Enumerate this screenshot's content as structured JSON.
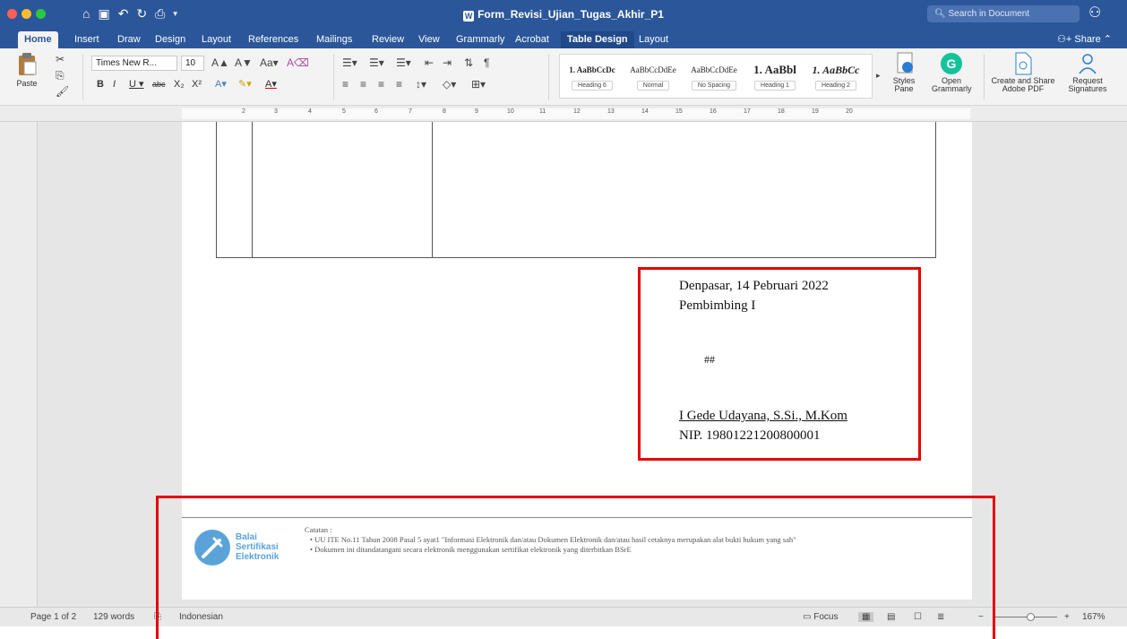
{
  "window": {
    "title": "Form_Revisi_Ujian_Tugas_Akhir_P1",
    "search_placeholder": "Search in Document",
    "traffic_colors": [
      "#fd5f57",
      "#febc2e",
      "#28c840"
    ]
  },
  "tabs": [
    {
      "label": "Home",
      "active": true
    },
    {
      "label": "Insert"
    },
    {
      "label": "Draw"
    },
    {
      "label": "Design"
    },
    {
      "label": "Layout"
    },
    {
      "label": "References"
    },
    {
      "label": "Mailings"
    },
    {
      "label": "Review"
    },
    {
      "label": "View"
    },
    {
      "label": "Grammarly"
    },
    {
      "label": "Acrobat"
    },
    {
      "label": "Table Design",
      "contextual": true
    },
    {
      "label": "Layout"
    }
  ],
  "share_label": "Share",
  "ribbon": {
    "paste_label": "Paste",
    "font_name": "Times New R...",
    "font_size": "10",
    "styles": [
      {
        "sample": "1. AaBbCcDc",
        "name": "Heading 6"
      },
      {
        "sample": "AaBbCcDdEe",
        "name": "Normal"
      },
      {
        "sample": "AaBbCcDdEe",
        "name": "No Spacing"
      },
      {
        "sample": "1. AaBbl",
        "name": "Heading 1"
      },
      {
        "sample": "1. AaBbCc",
        "name": "Heading 2"
      }
    ],
    "styles_pane_label": "Styles Pane",
    "open_grammarly_label": "Open Grammarly",
    "create_share_pdf_label": "Create and Share Adobe PDF",
    "request_signatures_label": "Request Signatures"
  },
  "ruler_numbers": [
    "2",
    "3",
    "4",
    "5",
    "6",
    "7",
    "8",
    "9",
    "10",
    "11",
    "12",
    "13",
    "14",
    "15",
    "16",
    "17",
    "18",
    "19",
    "20"
  ],
  "document": {
    "place_date": "Denpasar, 14 Pebruari 2022",
    "role": "Pembimbing I",
    "signature_placeholder": "##",
    "signer_name": "I Gede Udayana, S.Si., M.Kom",
    "signer_nip": "NIP. 19801221200800001"
  },
  "footer": {
    "logo_lines": [
      "Balai",
      "Sertifikasi",
      "Elektronik"
    ],
    "notes_title": "Catatan :",
    "notes": [
      "UU ITE No.11 Tahun 2008 Pasal 5 ayat1 \"Informasi Elektronik dan/atau Dokumen Elektronik dan/atau hasil cetaknya merupakan alat bukti hukum yang sah\"",
      "Dokumen ini ditandatangani secara elektronik menggunakan sertifikat elektronik yang diterbitkan BSrE"
    ]
  },
  "statusbar": {
    "page": "Page 1 of 2",
    "words": "129 words",
    "language": "Indonesian",
    "focus": "Focus",
    "zoom": "167%"
  },
  "colors": {
    "ribbon_blue": "#2b579a",
    "highlight_red": "#e60000",
    "bsre_blue": "#5aa3d8"
  }
}
